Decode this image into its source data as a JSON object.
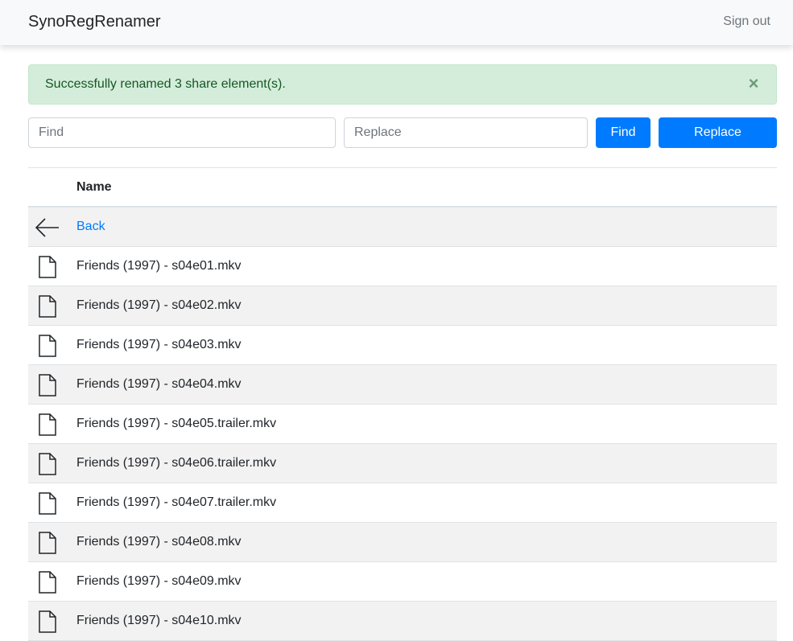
{
  "navbar": {
    "brand": "SynoRegRenamer",
    "signout_label": "Sign out"
  },
  "alert": {
    "message": "Successfully renamed 3 share element(s).",
    "close_glyph": "×",
    "color": "#d4edda"
  },
  "search": {
    "find_placeholder": "Find",
    "find_value": "",
    "replace_placeholder": "Replace",
    "replace_value": "",
    "find_button": "Find",
    "replace_button": "Replace",
    "accent_color": "#007bff"
  },
  "table": {
    "header_name": "Name",
    "back_row": {
      "icon": "arrow-left-icon",
      "label": "Back"
    },
    "rows": [
      {
        "icon": "file-icon",
        "name": "Friends (1997) - s04e01.mkv"
      },
      {
        "icon": "file-icon",
        "name": "Friends (1997) - s04e02.mkv"
      },
      {
        "icon": "file-icon",
        "name": "Friends (1997) - s04e03.mkv"
      },
      {
        "icon": "file-icon",
        "name": "Friends (1997) - s04e04.mkv"
      },
      {
        "icon": "file-icon",
        "name": "Friends (1997) - s04e05.trailer.mkv"
      },
      {
        "icon": "file-icon",
        "name": "Friends (1997) - s04e06.trailer.mkv"
      },
      {
        "icon": "file-icon",
        "name": "Friends (1997) - s04e07.trailer.mkv"
      },
      {
        "icon": "file-icon",
        "name": "Friends (1997) - s04e08.mkv"
      },
      {
        "icon": "file-icon",
        "name": "Friends (1997) - s04e09.mkv"
      },
      {
        "icon": "file-icon",
        "name": "Friends (1997) - s04e10.mkv"
      }
    ]
  }
}
